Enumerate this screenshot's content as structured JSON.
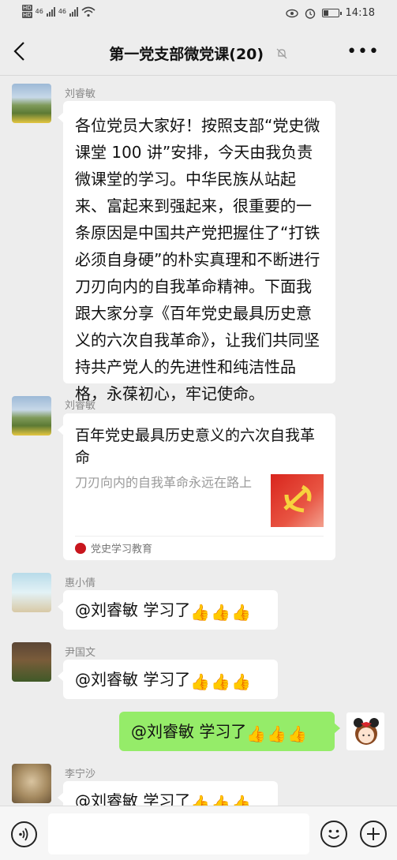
{
  "status": {
    "time": "14:18",
    "net1": "46",
    "net2": "46",
    "hd": "HD"
  },
  "header": {
    "title": "第一党支部微党课(20)"
  },
  "messages": {
    "m1": {
      "sender": "刘睿敏",
      "text": "各位党员大家好！按照支部“党史微课堂 100 讲”安排，今天由我负责微课堂的学习。中华民族从站起来、富起来到强起来，很重要的一条原因是中国共产党把握住了“打铁必须自身硬”的朴实真理和不断进行刀刃向内的自我革命精神。下面我跟大家分享《百年党史最具历史意义的六次自我革命》，让我们共同坚持共产党人的先进性和纯洁性品格，永葆初心，牢记使命。"
    },
    "m2": {
      "sender": "刘睿敏",
      "card_title": "百年党史最具历史意义的六次自我革命",
      "card_desc": "刀刃向内的自我革命永远在路上",
      "card_source": "党史学习教育"
    },
    "m3": {
      "sender": "惠小倩",
      "text": "@刘睿敏  学习了"
    },
    "m4": {
      "sender": "尹国文",
      "text": "@刘睿敏  学习了"
    },
    "m5": {
      "text": "@刘睿敏  学习了"
    },
    "m6": {
      "sender": "李宁沙",
      "text": "@刘睿敏  学习了"
    }
  },
  "thumbs": "👍",
  "colors": {
    "self_bubble": "#95ec69",
    "background": "#ededed"
  }
}
